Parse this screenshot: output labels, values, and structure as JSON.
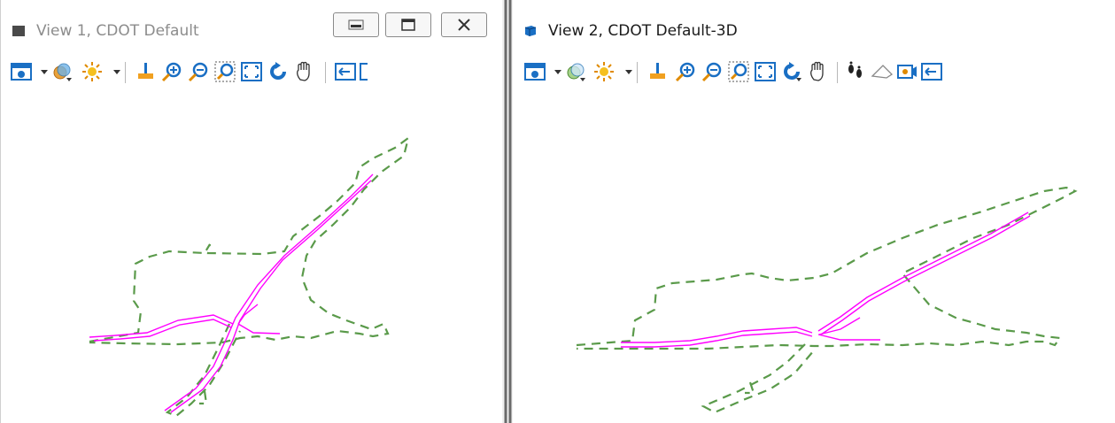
{
  "view1": {
    "title": "View 1, CDOT Default",
    "icon": "view-window-icon",
    "window_buttons": [
      "minimize-icon",
      "maximize-icon",
      "close-icon"
    ],
    "toolbar_icons": [
      "view-attributes-icon",
      "dropdown-arrow-icon",
      "display-style-icon",
      "light-icon",
      "dropdown-arrow-icon",
      "update-view-icon",
      "zoom-in-icon",
      "zoom-out-icon",
      "window-area-icon",
      "fit-view-icon",
      "rotate-view-icon",
      "pan-view-icon",
      "previous-view-icon"
    ]
  },
  "view2": {
    "title": "View 2, CDOT Default-3D",
    "icon": "3d-view-icon",
    "toolbar_icons": [
      "view-attributes-icon",
      "dropdown-arrow-icon",
      "display-style-icon",
      "light-icon",
      "dropdown-arrow-icon",
      "update-view-icon",
      "zoom-in-icon",
      "zoom-out-icon",
      "window-area-icon",
      "fit-view-icon",
      "rotate-view-icon",
      "pan-view-icon",
      "walk-icon",
      "fly-icon",
      "camera-icon",
      "previous-view-icon"
    ]
  },
  "colors": {
    "alignment": "#ff00ff",
    "boundary": "#5a9a4a",
    "title_inactive": "#8c8c8c",
    "title_active": "#1a1a1a",
    "icon_blue": "#1a6fc4"
  }
}
